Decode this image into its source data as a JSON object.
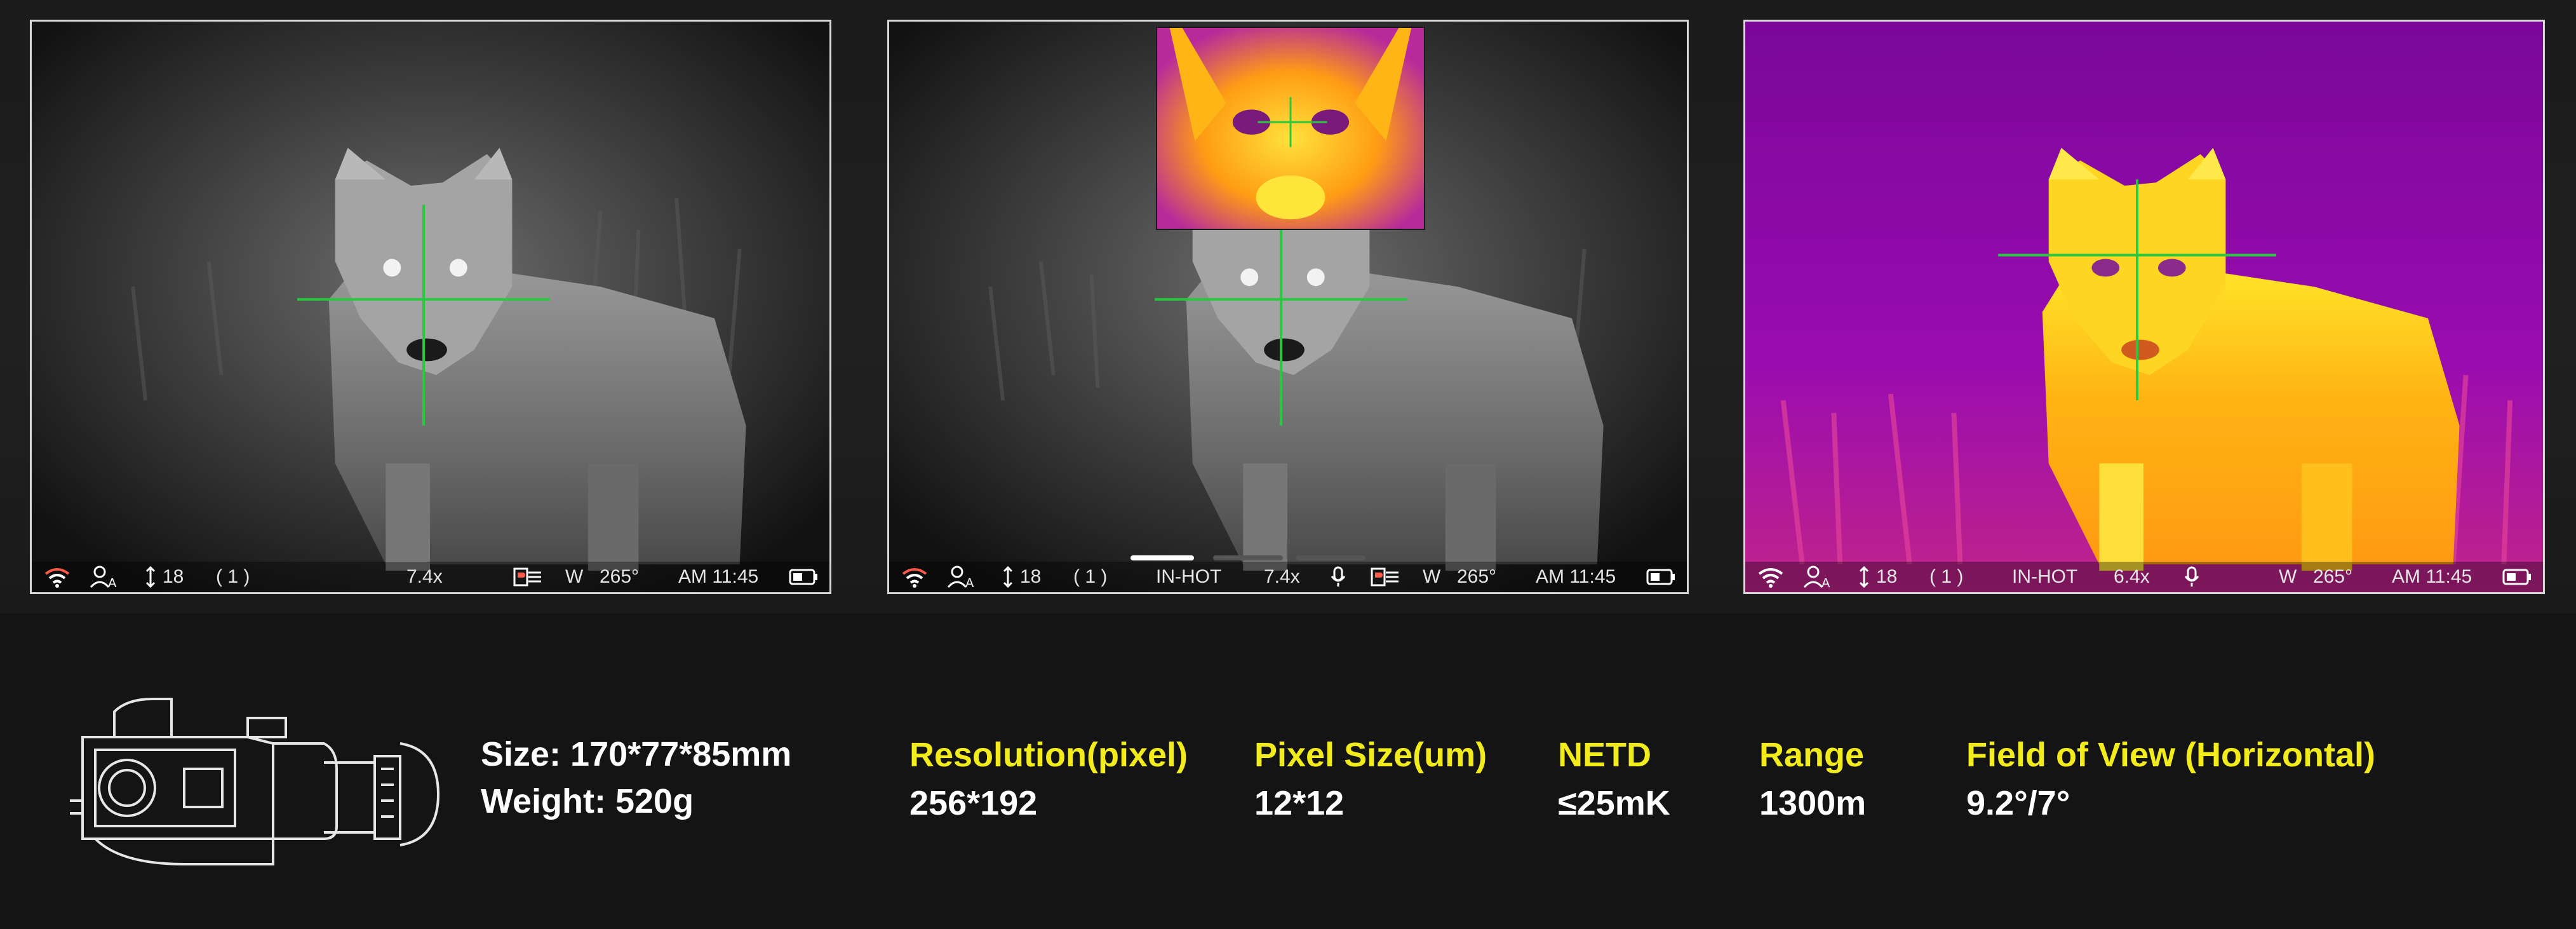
{
  "screens": [
    {
      "mode": "white-hot",
      "status": {
        "elevation": "18",
        "reticle": "( 1 )",
        "zoom": "7.4x",
        "heading_dir": "W",
        "heading_deg": "265°",
        "time": "AM 11:45"
      }
    },
    {
      "mode": "white-hot-pip",
      "status": {
        "elevation": "18",
        "reticle": "( 1 )",
        "palette": "IN-HOT",
        "zoom": "7.4x",
        "heading_dir": "W",
        "heading_deg": "265°",
        "time": "AM 11:45"
      }
    },
    {
      "mode": "iron-hot",
      "status": {
        "elevation": "18",
        "reticle": "( 1 )",
        "palette": "IN-HOT",
        "zoom": "6.4x",
        "heading_dir": "W",
        "heading_deg": "265°",
        "time": "AM 11:45"
      }
    }
  ],
  "colors": {
    "spec_label": "#f3ec1d",
    "spec_value": "#ffffff",
    "crosshair": "#27c93f",
    "iron_purple": "#8a0aa8",
    "iron_orange": "#ff8a10",
    "iron_yellow": "#ffee2a"
  },
  "icons": [
    "wifi-icon",
    "auto-profile-icon",
    "elevation-arrow-icon",
    "rangefinder-icon",
    "microphone-icon",
    "battery-icon"
  ],
  "specs": {
    "size": "Size: 170*77*85mm",
    "weight": "Weight: 520g",
    "resolution_label": "Resolution(pixel)",
    "resolution_value": "256*192",
    "pixel_size_label": "Pixel Size(um)",
    "pixel_size_value": "12*12",
    "netd_label": "NETD",
    "netd_value": "≤25mK",
    "range_label": "Range",
    "range_value": "1300m",
    "fov_label": "Field of View (Horizontal)",
    "fov_value": "9.2°/7°"
  }
}
